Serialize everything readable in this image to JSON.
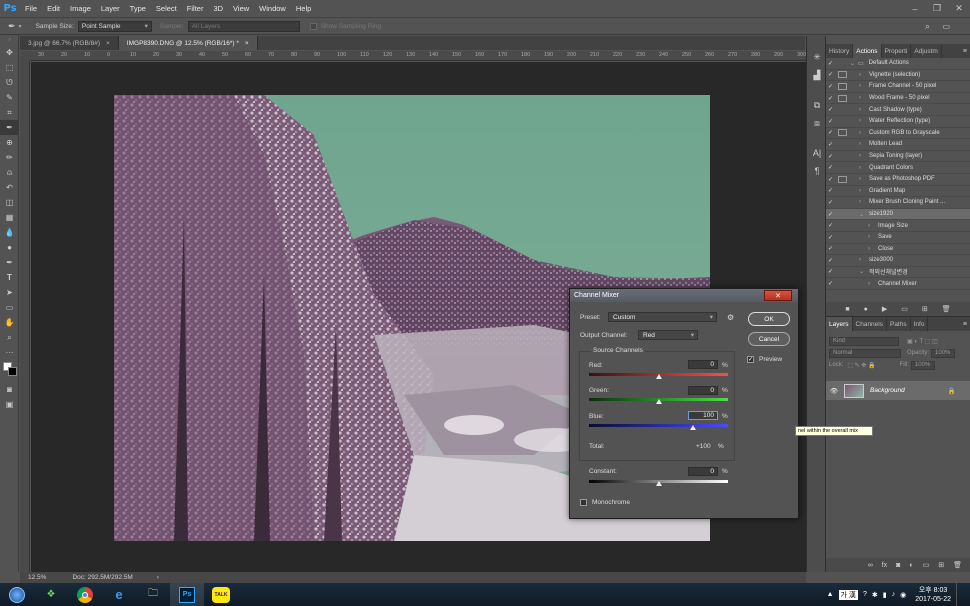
{
  "app": {
    "logo": "Ps"
  },
  "menu": [
    "File",
    "Edit",
    "Image",
    "Layer",
    "Type",
    "Select",
    "Filter",
    "3D",
    "View",
    "Window",
    "Help"
  ],
  "options": {
    "sample_size_label": "Sample Size:",
    "sample_size_value": "Point Sample",
    "sample_label": "Sample:",
    "sample_value": "All Layers",
    "show_ring": "Show Sampling Ring"
  },
  "tabs": [
    {
      "label": "3.jpg @ 66.7% (RGB/8#)",
      "close": "×"
    },
    {
      "label": "IMGP8390.DNG @ 12.5% (RGB/16*) *",
      "close": "×"
    }
  ],
  "ruler_ticks": [
    "30",
    "20",
    "10",
    "0",
    "10",
    "20",
    "30",
    "40",
    "50",
    "60",
    "70",
    "80",
    "90",
    "100",
    "110",
    "120",
    "130",
    "140",
    "150",
    "160",
    "170",
    "180",
    "190",
    "200",
    "210",
    "220",
    "230",
    "240",
    "250",
    "260",
    "270",
    "280",
    "290",
    "300"
  ],
  "status": {
    "zoom": "12.5%",
    "doc": "Doc: 292.5M/292.5M",
    "arrow": "›"
  },
  "right_panel": {
    "tabs": [
      "History",
      "Actions",
      "Properti",
      "Adjustm"
    ],
    "actions": [
      {
        "label": "Default Actions",
        "level": 0,
        "dlg": false,
        "folder": true
      },
      {
        "label": "Vignette (selection)",
        "level": 1,
        "dlg": true
      },
      {
        "label": "Frame Channel - 50 pixel",
        "level": 1,
        "dlg": true
      },
      {
        "label": "Wood Frame - 50 pixel",
        "level": 1,
        "dlg": true
      },
      {
        "label": "Cast Shadow (type)",
        "level": 1,
        "dlg": false
      },
      {
        "label": "Water Reflection (type)",
        "level": 1,
        "dlg": false
      },
      {
        "label": "Custom RGB to Grayscale",
        "level": 1,
        "dlg": true
      },
      {
        "label": "Molten Lead",
        "level": 1,
        "dlg": false
      },
      {
        "label": "Sepia Toning (layer)",
        "level": 1,
        "dlg": false
      },
      {
        "label": "Quadrant Colors",
        "level": 1,
        "dlg": false
      },
      {
        "label": "Save as Photoshop PDF",
        "level": 1,
        "dlg": true
      },
      {
        "label": "Gradient Map",
        "level": 1,
        "dlg": false
      },
      {
        "label": "Mixer Brush Cloning Paint ...",
        "level": 1,
        "dlg": false
      },
      {
        "label": "size1920",
        "level": 1,
        "dlg": false,
        "selected": true
      },
      {
        "label": "Image Size",
        "level": 2,
        "dlg": false
      },
      {
        "label": "Save",
        "level": 2,
        "dlg": false
      },
      {
        "label": "Close",
        "level": 2,
        "dlg": false
      },
      {
        "label": "size3000",
        "level": 1,
        "dlg": false
      },
      {
        "label": "적외선채널변경",
        "level": 1,
        "dlg": false
      },
      {
        "label": "Channel Mixer",
        "level": 2,
        "dlg": false
      }
    ]
  },
  "layers_panel": {
    "tabs": [
      "Layers",
      "Channels",
      "Paths",
      "Info"
    ],
    "kind": "Kind",
    "blend": "Normal",
    "opacity_label": "Opacity:",
    "opacity_value": "100%",
    "lock_label": "Lock:",
    "fill_label": "Fill:",
    "fill_value": "100%",
    "layer_name": "Background"
  },
  "dialog": {
    "title": "Channel Mixer",
    "close": "✕",
    "preset_label": "Preset:",
    "preset_value": "Custom",
    "output_label": "Output Channel:",
    "output_value": "Red",
    "source_label": "Source Channels",
    "red_label": "Red:",
    "red_value": "0",
    "green_label": "Green:",
    "green_value": "0",
    "blue_label": "Blue:",
    "blue_value": "100",
    "pct": "%",
    "total_label": "Total:",
    "total_value": "+100",
    "constant_label": "Constant:",
    "constant_value": "0",
    "monochrome_label": "Monochrome",
    "ok_label": "OK",
    "cancel_label": "Cancel",
    "preview_label": "Preview",
    "sliders": {
      "red": 0,
      "green": 0,
      "blue": 100,
      "constant": 0
    }
  },
  "tooltip": "nel within the overall mix",
  "taskbar": {
    "talk": "TALK",
    "ime": "가 漢",
    "time": "오후 8:03",
    "date": "2017-05-22"
  }
}
